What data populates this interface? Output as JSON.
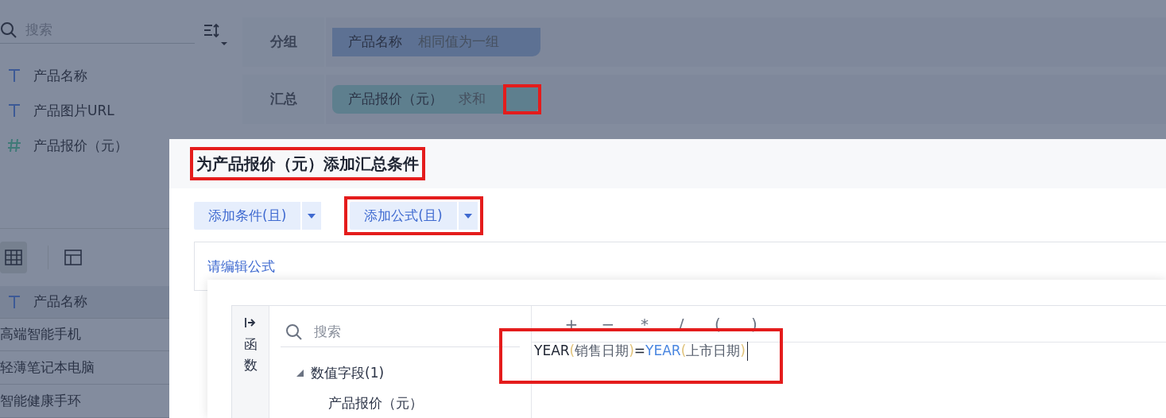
{
  "sidebar": {
    "search": {
      "placeholder": "搜索"
    },
    "fields": [
      {
        "kind": "text",
        "label": "产品名称"
      },
      {
        "kind": "text",
        "label": "产品图片URL"
      },
      {
        "kind": "number",
        "label": "产品报价（元）"
      }
    ],
    "views": [
      {
        "kind": "table",
        "selected": true
      },
      {
        "kind": "layout",
        "selected": false
      }
    ],
    "table": {
      "column": {
        "kind": "text",
        "label": "产品名称"
      },
      "rows": [
        "高端智能手机",
        "轻薄笔记本电脑",
        "智能健康手环"
      ]
    }
  },
  "config": [
    {
      "label": "分组",
      "kind": "group",
      "chip": {
        "field": "产品名称",
        "mode": "相同值为一组"
      },
      "slot_highlighted": false
    },
    {
      "label": "汇总",
      "kind": "summary",
      "chip": {
        "field": "产品报价（元）",
        "mode": "求和"
      },
      "slot_highlighted": true
    }
  ],
  "dialog": {
    "title": "为产品报价（元）添加汇总条件",
    "title_highlighted": true,
    "buttons": [
      {
        "label": "添加条件(且)",
        "highlighted": false
      },
      {
        "label": "添加公式(且)",
        "highlighted": true
      }
    ],
    "formula_placeholder": "请编辑公式",
    "editor": {
      "tab": "函数",
      "search": {
        "placeholder": "搜索"
      },
      "tree": [
        {
          "label": "数值字段(1)",
          "expanded": true,
          "children": [
            {
              "label": "产品报价（元）"
            }
          ]
        }
      ],
      "operators": [
        "+",
        "−",
        "*",
        "/",
        "(",
        ")"
      ],
      "highlighted": true,
      "formula": [
        {
          "kind": "text",
          "text": "YEAR"
        },
        {
          "kind": "paren",
          "text": "("
        },
        {
          "kind": "field",
          "text": "销售日期"
        },
        {
          "kind": "paren",
          "text": ")"
        },
        {
          "kind": "text",
          "text": "="
        },
        {
          "kind": "function",
          "text": "YEAR"
        },
        {
          "kind": "paren",
          "text": "("
        },
        {
          "kind": "field",
          "text": "上市日期"
        },
        {
          "kind": "paren",
          "text": ")"
        }
      ]
    }
  }
}
